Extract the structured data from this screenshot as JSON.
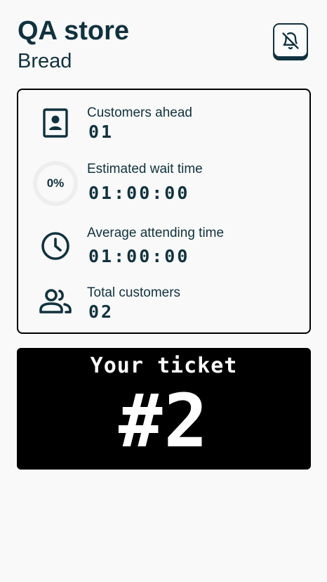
{
  "header": {
    "title": "QA store",
    "subtitle": "Bread"
  },
  "notifications": {
    "icon": "bell-off-icon",
    "state": "muted"
  },
  "stats": {
    "customers_ahead": {
      "icon": "person-badge-icon",
      "label": "Customers ahead",
      "value": "01"
    },
    "estimated_wait": {
      "progress_text": "0%",
      "progress_fraction": 0,
      "label": "Estimated wait time",
      "value": "01:00:00"
    },
    "average_attending": {
      "icon": "clock-icon",
      "label": "Average attending time",
      "value": "01:00:00"
    },
    "total_customers": {
      "icon": "people-icon",
      "label": "Total customers",
      "value": "02"
    }
  },
  "ticket": {
    "label": "Your ticket",
    "number": "#2"
  },
  "colors": {
    "primary": "#10323f",
    "background": "#f9f9f9",
    "ticket_background": "#000000",
    "ticket_text": "#ffffff",
    "progress_track": "#eeeeee"
  }
}
